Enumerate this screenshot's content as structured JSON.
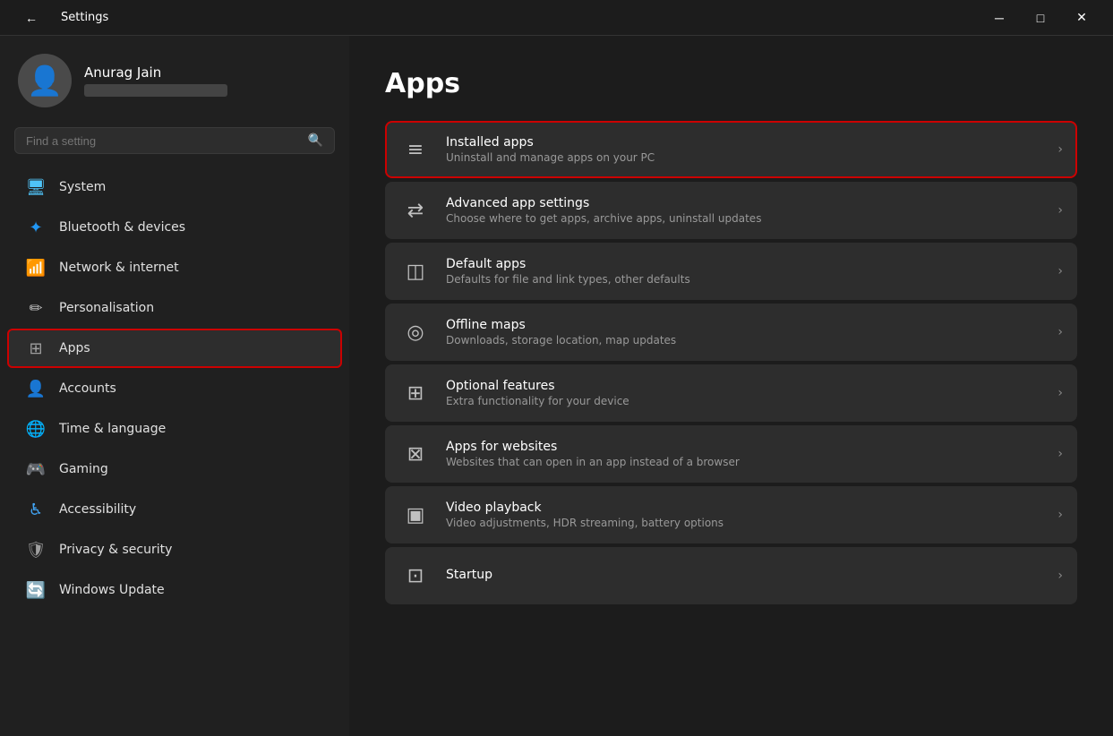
{
  "titlebar": {
    "back_icon": "←",
    "title": "Settings",
    "minimize_label": "─",
    "maximize_label": "□",
    "close_label": "✕"
  },
  "sidebar": {
    "user": {
      "name": "Anurag Jain"
    },
    "search": {
      "placeholder": "Find a setting"
    },
    "nav_items": [
      {
        "id": "system",
        "label": "System",
        "icon": "🖥",
        "active": false
      },
      {
        "id": "bluetooth",
        "label": "Bluetooth & devices",
        "icon": "⬡",
        "active": false
      },
      {
        "id": "network",
        "label": "Network & internet",
        "icon": "📶",
        "active": false
      },
      {
        "id": "personalisation",
        "label": "Personalisation",
        "icon": "✏",
        "active": false
      },
      {
        "id": "apps",
        "label": "Apps",
        "icon": "⊞",
        "active": true
      },
      {
        "id": "accounts",
        "label": "Accounts",
        "icon": "👤",
        "active": false
      },
      {
        "id": "time",
        "label": "Time & language",
        "icon": "🌐",
        "active": false
      },
      {
        "id": "gaming",
        "label": "Gaming",
        "icon": "🎮",
        "active": false
      },
      {
        "id": "accessibility",
        "label": "Accessibility",
        "icon": "♿",
        "active": false
      },
      {
        "id": "privacy",
        "label": "Privacy & security",
        "icon": "🛡",
        "active": false
      },
      {
        "id": "update",
        "label": "Windows Update",
        "icon": "🔄",
        "active": false
      }
    ]
  },
  "main": {
    "page_title": "Apps",
    "settings_items": [
      {
        "id": "installed-apps",
        "title": "Installed apps",
        "description": "Uninstall and manage apps on your PC",
        "highlighted": true
      },
      {
        "id": "advanced-app-settings",
        "title": "Advanced app settings",
        "description": "Choose where to get apps, archive apps, uninstall updates",
        "highlighted": false
      },
      {
        "id": "default-apps",
        "title": "Default apps",
        "description": "Defaults for file and link types, other defaults",
        "highlighted": false
      },
      {
        "id": "offline-maps",
        "title": "Offline maps",
        "description": "Downloads, storage location, map updates",
        "highlighted": false
      },
      {
        "id": "optional-features",
        "title": "Optional features",
        "description": "Extra functionality for your device",
        "highlighted": false
      },
      {
        "id": "apps-for-websites",
        "title": "Apps for websites",
        "description": "Websites that can open in an app instead of a browser",
        "highlighted": false
      },
      {
        "id": "video-playback",
        "title": "Video playback",
        "description": "Video adjustments, HDR streaming, battery options",
        "highlighted": false
      },
      {
        "id": "startup",
        "title": "Startup",
        "description": "",
        "highlighted": false
      }
    ]
  }
}
